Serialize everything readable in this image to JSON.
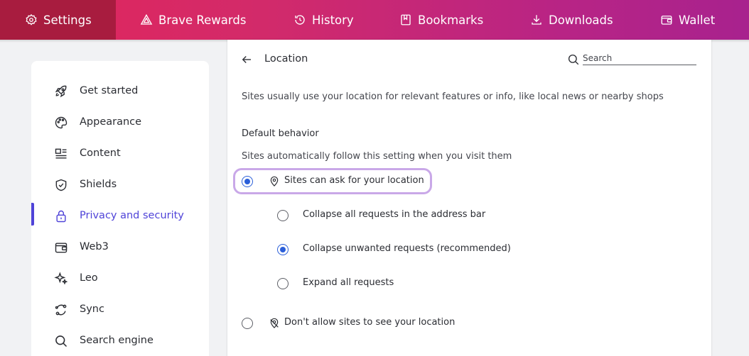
{
  "tabs": [
    {
      "label": "Settings",
      "icon": "gear-icon",
      "active": true
    },
    {
      "label": "Brave Rewards",
      "icon": "triangle-icon"
    },
    {
      "label": "History",
      "icon": "history-icon"
    },
    {
      "label": "Bookmarks",
      "icon": "bookmark-icon"
    },
    {
      "label": "Downloads",
      "icon": "download-icon"
    },
    {
      "label": "Wallet",
      "icon": "wallet-icon"
    }
  ],
  "sidebar": {
    "items": [
      {
        "label": "Get started",
        "icon": "rocket-icon"
      },
      {
        "label": "Appearance",
        "icon": "palette-icon"
      },
      {
        "label": "Content",
        "icon": "content-icon"
      },
      {
        "label": "Shields",
        "icon": "shield-icon"
      },
      {
        "label": "Privacy and security",
        "icon": "lock-icon",
        "active": true
      },
      {
        "label": "Web3",
        "icon": "wallet-icon"
      },
      {
        "label": "Leo",
        "icon": "sparkle-icon"
      },
      {
        "label": "Sync",
        "icon": "sync-icon"
      },
      {
        "label": "Search engine",
        "icon": "search-icon"
      }
    ]
  },
  "main": {
    "title": "Location",
    "search_placeholder": "Search",
    "description": "Sites usually use your location for relevant features or info, like local news or nearby shops",
    "default_behavior": {
      "title": "Default behavior",
      "subtitle": "Sites automatically follow this setting when you visit them",
      "ask_option": "Sites can ask for your location",
      "sub_options": [
        "Collapse all requests in the address bar",
        "Collapse unwanted requests (recommended)",
        "Expand all requests"
      ],
      "block_option": "Don't allow sites to see your location"
    }
  },
  "colors": {
    "accent": "#4f43d8",
    "radio": "#2b5fd9",
    "highlight": "#c9a8e8"
  }
}
